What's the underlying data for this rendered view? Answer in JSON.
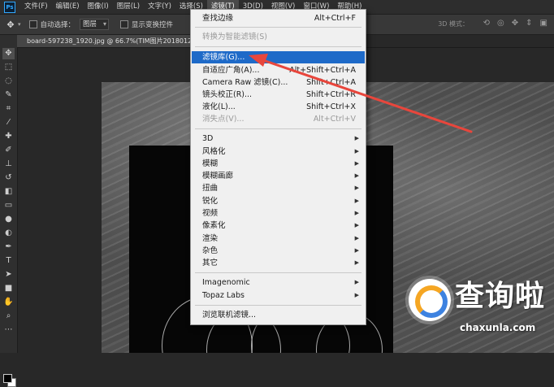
{
  "menubar": {
    "items": [
      "文件(F)",
      "编辑(E)",
      "图像(I)",
      "图层(L)",
      "文字(Y)",
      "选择(S)",
      "滤镜(T)",
      "3D(D)",
      "视图(V)",
      "窗口(W)",
      "帮助(H)"
    ],
    "active": "滤镜(T)"
  },
  "options": {
    "auto_select_label": "自动选择：",
    "auto_select_value": "图层",
    "show_transform_label": "显示变换控件",
    "mode_3d_label": "3D 模式："
  },
  "document": {
    "tab_title": "board-597238_1920.jpg @ 66.7%(TIM图片20180127125"
  },
  "filter_menu": {
    "items": [
      {
        "label": "查找边缘",
        "shortcut": "Alt+Ctrl+F",
        "state": "normal"
      },
      {
        "label": "转换为智能滤镜(S)",
        "shortcut": "",
        "state": "disabled"
      },
      {
        "label": "滤镜库(G)...",
        "shortcut": "",
        "state": "highlighted"
      },
      {
        "label": "自适应广角(A)...",
        "shortcut": "Alt+Shift+Ctrl+A",
        "state": "normal"
      },
      {
        "label": "Camera Raw 滤镜(C)...",
        "shortcut": "Shift+Ctrl+A",
        "state": "normal"
      },
      {
        "label": "镜头校正(R)...",
        "shortcut": "Shift+Ctrl+R",
        "state": "normal"
      },
      {
        "label": "液化(L)...",
        "shortcut": "Shift+Ctrl+X",
        "state": "normal"
      },
      {
        "label": "消失点(V)...",
        "shortcut": "Alt+Ctrl+V",
        "state": "disabled"
      }
    ],
    "submenus": [
      "3D",
      "风格化",
      "模糊",
      "模糊画廊",
      "扭曲",
      "锐化",
      "视频",
      "像素化",
      "渲染",
      "杂色",
      "其它"
    ],
    "plugins": [
      "Imagenomic",
      "Topaz Labs"
    ],
    "browse_online": "浏览联机滤镜..."
  },
  "watermark": {
    "brand": "查询啦",
    "url": "chaxunla.com"
  },
  "colors": {
    "menu_highlight": "#1e6ac8",
    "annotation_arrow": "#e8463c"
  }
}
